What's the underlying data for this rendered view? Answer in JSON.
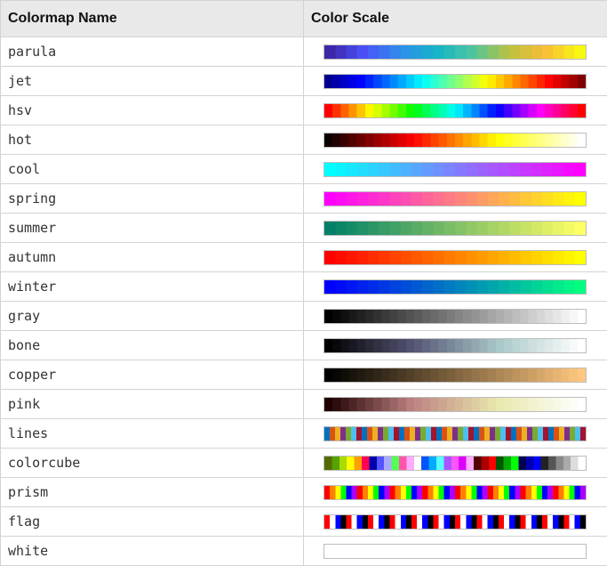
{
  "table": {
    "headers": {
      "name": "Colormap Name",
      "scale": "Color Scale"
    },
    "rows": [
      {
        "name": "parula",
        "icon": "parula-colorbar",
        "stops": [
          "#3e26a8",
          "#4a53fb",
          "#2d8fea",
          "#14b4c8",
          "#4ec69e",
          "#b9c240",
          "#f9bc37",
          "#f8f810"
        ],
        "steps": 24
      },
      {
        "name": "jet",
        "icon": "jet-colorbar",
        "stops": [
          "#00008f",
          "#0000ff",
          "#0080ff",
          "#00ffff",
          "#80ff80",
          "#ffff00",
          "#ff8000",
          "#ff0000",
          "#800000"
        ],
        "steps": 32
      },
      {
        "name": "hsv",
        "icon": "hsv-colorbar",
        "stops": [
          "#ff0000",
          "#ffff00",
          "#00ff00",
          "#00ffff",
          "#0000ff",
          "#ff00ff",
          "#ff0000"
        ],
        "steps": 32
      },
      {
        "name": "hot",
        "icon": "hot-colorbar",
        "stops": [
          "#0b0000",
          "#ff0000",
          "#ffff00",
          "#ffffff"
        ],
        "steps": 32
      },
      {
        "name": "cool",
        "icon": "cool-colorbar",
        "stops": [
          "#00ffff",
          "#ff00ff"
        ],
        "steps": 24
      },
      {
        "name": "spring",
        "icon": "spring-colorbar",
        "stops": [
          "#ff00ff",
          "#ffff00"
        ],
        "steps": 24
      },
      {
        "name": "summer",
        "icon": "summer-colorbar",
        "stops": [
          "#008066",
          "#ffff66"
        ],
        "steps": 24
      },
      {
        "name": "autumn",
        "icon": "autumn-colorbar",
        "stops": [
          "#ff0000",
          "#ffff00"
        ],
        "steps": 24
      },
      {
        "name": "winter",
        "icon": "winter-colorbar",
        "stops": [
          "#0000ff",
          "#00ff80"
        ],
        "steps": 24
      },
      {
        "name": "gray",
        "icon": "gray-colorbar",
        "stops": [
          "#000000",
          "#ffffff"
        ],
        "steps": 32
      },
      {
        "name": "bone",
        "icon": "bone-colorbar",
        "stops": [
          "#000000",
          "#545474",
          "#a7c7c7",
          "#ffffff"
        ],
        "steps": 32
      },
      {
        "name": "copper",
        "icon": "copper-colorbar",
        "stops": [
          "#000000",
          "#ffc77f"
        ],
        "steps": 32
      },
      {
        "name": "pink",
        "icon": "pink-colorbar",
        "stops": [
          "#1e0000",
          "#be8282",
          "#e8e8ac",
          "#ffffff"
        ],
        "steps": 32
      },
      {
        "name": "lines",
        "icon": "lines-colorbar",
        "cycle": [
          "#0072bd",
          "#d95319",
          "#edb120",
          "#7e2f8e",
          "#77ac30",
          "#4dbeee",
          "#a2142f"
        ],
        "steps": 49
      },
      {
        "name": "colorcube",
        "icon": "colorcube-colorbar",
        "explicit": [
          "#556b00",
          "#55a200",
          "#aadb00",
          "#ffff00",
          "#ff9f00",
          "#ff0055",
          "#0000aa",
          "#5555ff",
          "#aaaaff",
          "#55ff55",
          "#ff55aa",
          "#ffaaff",
          "#ffffff",
          "#0055ff",
          "#00aaff",
          "#55ffff",
          "#aa55ff",
          "#ff55ff",
          "#dd00ff",
          "#ffaaff",
          "#550000",
          "#aa0000",
          "#ff0000",
          "#005500",
          "#00aa00",
          "#00ff00",
          "#000055",
          "#0000aa",
          "#0000ff",
          "#222222",
          "#555555",
          "#888888",
          "#aaaaaa",
          "#dddddd",
          "#ffffff"
        ]
      },
      {
        "name": "prism",
        "icon": "prism-colorbar",
        "cycle": [
          "#ff0000",
          "#ff8000",
          "#ffff00",
          "#00ff00",
          "#0000ff",
          "#aa00ff"
        ],
        "steps": 48
      },
      {
        "name": "flag",
        "icon": "flag-colorbar",
        "cycle": [
          "#ff0000",
          "#ffffff",
          "#0000ff",
          "#000000"
        ],
        "steps": 48
      },
      {
        "name": "white",
        "icon": "white-colorbar",
        "stops": [
          "#ffffff",
          "#ffffff"
        ],
        "steps": 1
      }
    ]
  }
}
